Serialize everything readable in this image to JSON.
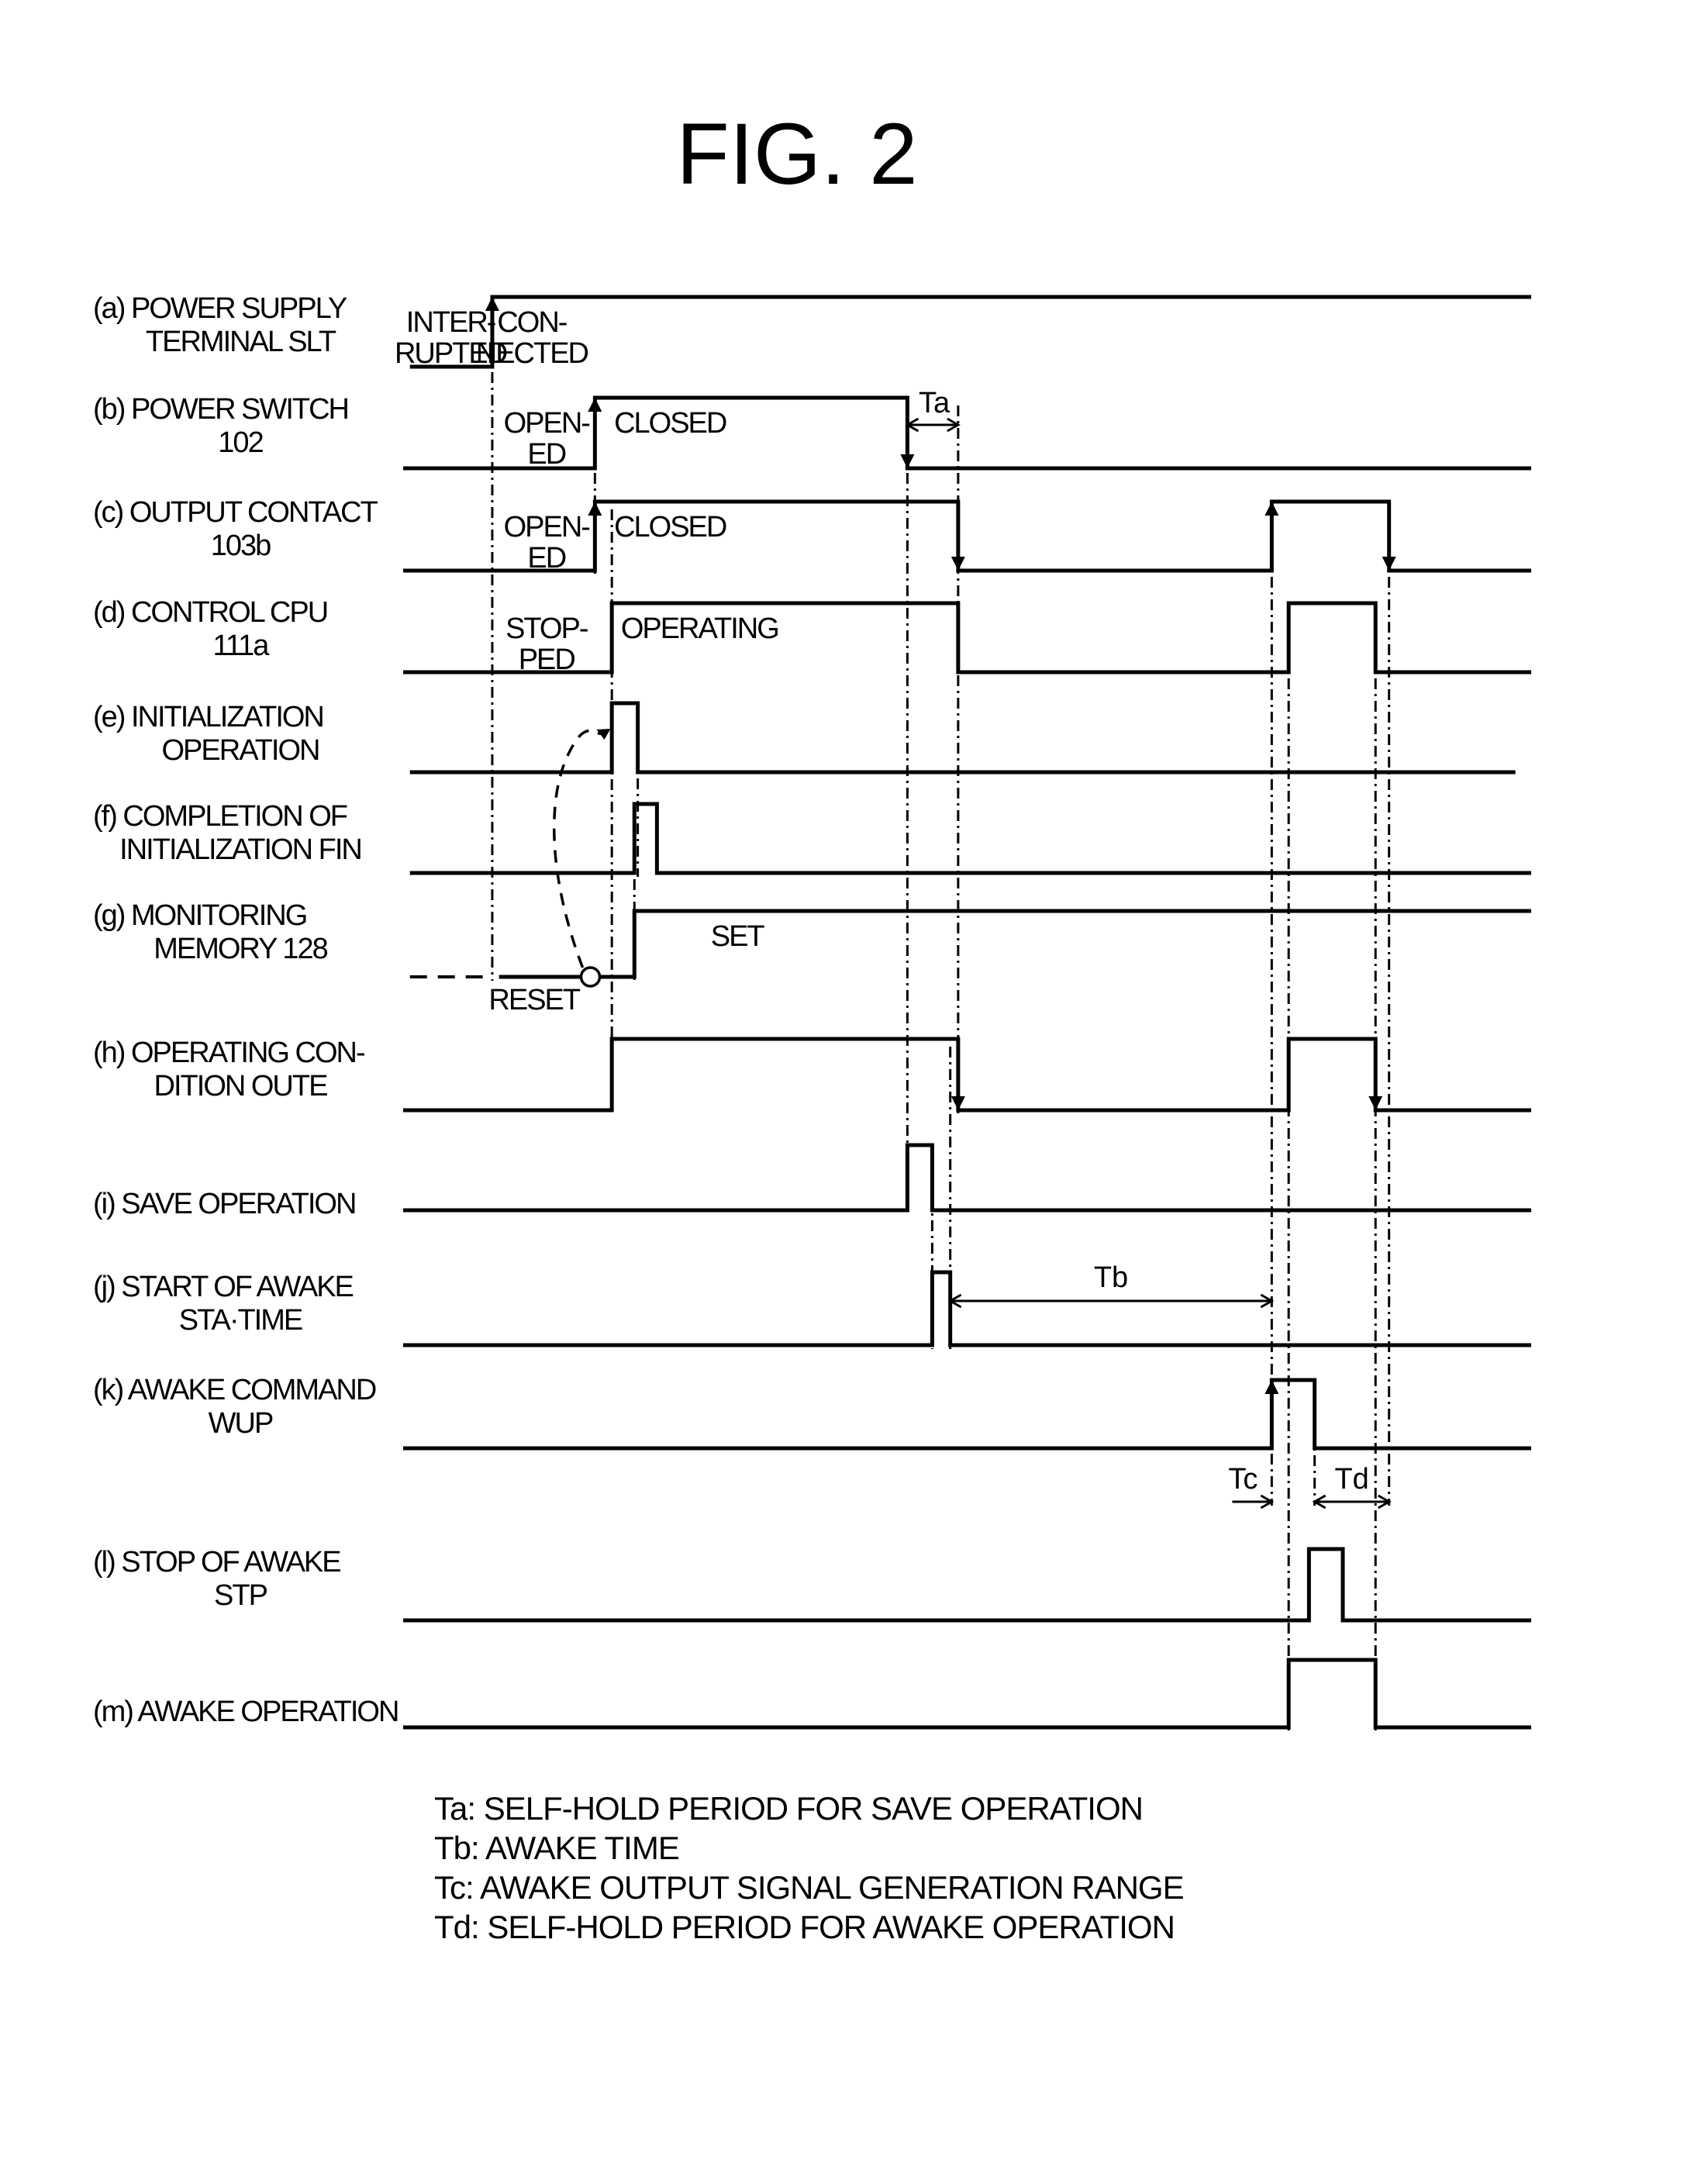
{
  "title": "FIG. 2",
  "chart_data": {
    "type": "timing-diagram",
    "time_range": [
      0,
      100
    ],
    "signals": [
      {
        "id": "a",
        "label_line1": "(a)  POWER SUPPLY",
        "label_line2": "TERMINAL SLT",
        "start": 0.6,
        "initial": 0,
        "edges": [
          {
            "t": 7.9,
            "to": 1,
            "arrow": true
          }
        ],
        "states": [
          {
            "text1": "INTER-",
            "text2": "RUPTED",
            "at": 4.2,
            "anchor": "middle"
          },
          {
            "text1": "CON-",
            "text2": "NECTED",
            "at": 11.4,
            "anchor": "middle"
          }
        ]
      },
      {
        "id": "b",
        "label_line1": "(b)  POWER SWITCH",
        "label_line2": "102",
        "start": 0.0,
        "initial": 0,
        "edges": [
          {
            "t": 17.0,
            "to": 1,
            "arrow": true
          },
          {
            "t": 44.7,
            "to": 0,
            "arrow": true
          }
        ],
        "states": [
          {
            "text1": "OPEN-",
            "text2": "ED",
            "at": 12.7,
            "anchor": "middle"
          },
          {
            "text1": "CLOSED",
            "text2": "",
            "at": 18.7,
            "anchor": "start"
          }
        ]
      },
      {
        "id": "c",
        "label_line1": "(c)  OUTPUT CONTACT",
        "label_line2": "103b",
        "start": 0.0,
        "initial": 0,
        "edges": [
          {
            "t": 17.0,
            "to": 1,
            "arrow": true
          },
          {
            "t": 49.2,
            "to": 0,
            "arrow": true
          },
          {
            "t": 77.0,
            "to": 1,
            "arrow": true
          },
          {
            "t": 87.4,
            "to": 0,
            "arrow": true
          }
        ],
        "states": [
          {
            "text1": "OPEN-",
            "text2": "ED",
            "at": 12.7,
            "anchor": "middle"
          },
          {
            "text1": "CLOSED",
            "text2": "",
            "at": 18.7,
            "anchor": "start"
          }
        ]
      },
      {
        "id": "d",
        "label_line1": "(d)  CONTROL CPU",
        "label_line2": "111a",
        "start": 0.0,
        "initial": 0,
        "edges": [
          {
            "t": 18.5,
            "to": 1
          },
          {
            "t": 49.2,
            "to": 0
          },
          {
            "t": 78.5,
            "to": 1
          },
          {
            "t": 86.2,
            "to": 0
          }
        ],
        "states": [
          {
            "text1": "STOP-",
            "text2": "PED",
            "at": 12.7,
            "anchor": "middle"
          },
          {
            "text1": "OPERATING",
            "text2": "",
            "at": 19.3,
            "anchor": "start"
          }
        ]
      },
      {
        "id": "e",
        "label_line1": "(e)  INITIALIZATION",
        "label_line2": "OPERATION",
        "start": 0.6,
        "end": 98.6,
        "initial": 0,
        "edges": [
          {
            "t": 18.5,
            "to": 1
          },
          {
            "t": 20.8,
            "to": 0
          }
        ],
        "states": []
      },
      {
        "id": "f",
        "label_line1": "(f)   COMPLETION OF",
        "label_line2": "INITIALIZATION FIN",
        "start": 0.6,
        "initial": 0,
        "edges": [
          {
            "t": 20.5,
            "to": 1
          },
          {
            "t": 22.5,
            "to": 0
          }
        ],
        "states": []
      },
      {
        "id": "g",
        "label_line1": "(g)      MONITORING",
        "label_line2": "MEMORY 128",
        "start": 8.5,
        "initial": 0,
        "pre_dashed_from": 0.6,
        "edges": [
          {
            "t": 20.5,
            "to": 1
          }
        ],
        "states": [
          {
            "text1": "RESET",
            "text2": "",
            "at": 11.6,
            "anchor": "middle",
            "below": true
          },
          {
            "text1": "SET",
            "text2": "",
            "at": 29.6,
            "anchor": "middle"
          }
        ]
      },
      {
        "id": "h",
        "label_line1": "(h)   OPERATING CON-",
        "label_line2": "DITION OUTE",
        "start": 0.0,
        "initial": 0,
        "edges": [
          {
            "t": 18.5,
            "to": 1
          },
          {
            "t": 49.2,
            "to": 0,
            "arrow": true
          },
          {
            "t": 78.5,
            "to": 1
          },
          {
            "t": 86.2,
            "to": 0,
            "arrow": true
          }
        ],
        "states": []
      },
      {
        "id": "i",
        "label_line1": "(i)   SAVE OPERATION",
        "label_line2": "",
        "start": 0.0,
        "initial": 0,
        "edges": [
          {
            "t": 44.7,
            "to": 1
          },
          {
            "t": 46.9,
            "to": 0
          }
        ],
        "states": []
      },
      {
        "id": "j",
        "label_line1": "(j)   START OF AWAKE",
        "label_line2": "STA·TIME",
        "start": 0.0,
        "initial": 0,
        "edges": [
          {
            "t": 46.9,
            "to": 1
          },
          {
            "t": 48.5,
            "to": 0
          }
        ],
        "states": []
      },
      {
        "id": "k",
        "label_line1": "(k)  AWAKE COMMAND",
        "label_line2": "WUP",
        "start": 0.0,
        "initial": 0,
        "edges": [
          {
            "t": 77.0,
            "to": 1,
            "arrow": true
          },
          {
            "t": 80.8,
            "to": 0
          }
        ],
        "states": []
      },
      {
        "id": "l",
        "label_line1": "(l)    STOP OF AWAKE",
        "label_line2": "STP",
        "start": 0.0,
        "initial": 0,
        "edges": [
          {
            "t": 80.3,
            "to": 1
          },
          {
            "t": 83.3,
            "to": 0
          }
        ],
        "states": []
      },
      {
        "id": "m",
        "label_line1": "(m) AWAKE OPERATION",
        "label_line2": "",
        "start": 0.0,
        "initial": 0,
        "edges": [
          {
            "t": 78.5,
            "to": 1
          },
          {
            "t": 86.2,
            "to": 0
          }
        ],
        "states": []
      }
    ],
    "guides": [
      {
        "t": 7.9,
        "from": "a",
        "to": "g"
      },
      {
        "t": 17.0,
        "from": "b",
        "to": "c"
      },
      {
        "t": 18.5,
        "from": "c",
        "to": "h"
      },
      {
        "t": 20.8,
        "from": "e",
        "to": "f"
      },
      {
        "t": 20.5,
        "from": "f",
        "to": "g"
      },
      {
        "t": 44.7,
        "from": "b",
        "to": "i"
      },
      {
        "t": 49.2,
        "from": "b",
        "to": "h"
      },
      {
        "t": 46.9,
        "from": "i",
        "to": "j"
      },
      {
        "t": 48.5,
        "from": "h",
        "to": "j"
      },
      {
        "t": 77.0,
        "from": "c",
        "to": "k_dim"
      },
      {
        "t": 78.5,
        "from": "d",
        "to": "m"
      },
      {
        "t": 80.8,
        "from": "k",
        "to": "k_dim"
      },
      {
        "t": 86.2,
        "from": "d",
        "to": "m"
      },
      {
        "t": 87.4,
        "from": "c",
        "to": "k_dim"
      }
    ],
    "intervals": [
      {
        "name": "Ta",
        "from": 44.7,
        "to": 49.2,
        "row": "b",
        "label": "Ta"
      },
      {
        "name": "Tb",
        "from": 48.5,
        "to": 77.0,
        "row": "j",
        "label": "Tb"
      },
      {
        "name": "Tc",
        "from": 73.5,
        "to": 77.0,
        "row": "k_dim",
        "label": "Tc",
        "one_sided": true
      },
      {
        "name": "Td",
        "from": 80.8,
        "to": 87.4,
        "row": "k_dim",
        "label": "Td"
      }
    ],
    "annotation": "reset-to-initialization dashed arrow from (g) RESET to (e) rising edge"
  },
  "legend": [
    "Ta: SELF-HOLD PERIOD FOR SAVE OPERATION",
    "Tb: AWAKE TIME",
    "Tc: AWAKE OUTPUT SIGNAL GENERATION RANGE",
    "Td: SELF-HOLD PERIOD FOR AWAKE OPERATION"
  ]
}
